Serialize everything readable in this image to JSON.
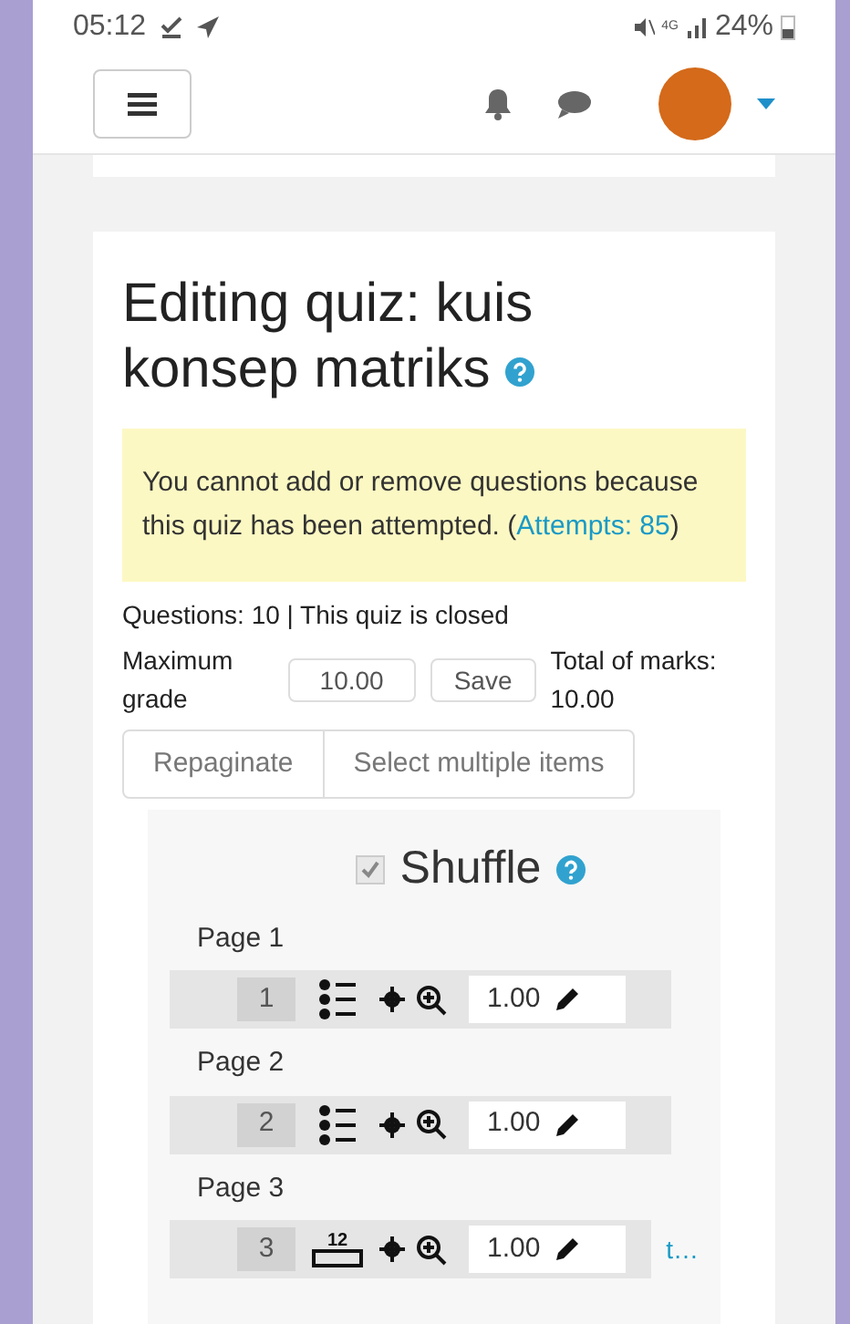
{
  "status_bar": {
    "time": "05:12",
    "network": "4G",
    "battery": "24%"
  },
  "heading": {
    "title": "Editing quiz: kuis konsep matriks"
  },
  "notice": {
    "text": "You cannot add or remove questions because this quiz has been attempted.",
    "open": "(",
    "link": "Attempts: 85",
    "close": ")"
  },
  "info": {
    "summary": "Questions: 10 | This quiz is closed",
    "max_grade_label": "Maximum grade",
    "max_grade_value": "10.00",
    "total": "Total of marks: 10.00",
    "save": "Save"
  },
  "actions": [
    "Repaginate",
    "Select multiple items"
  ],
  "shuffle": {
    "label": "Shuffle",
    "checked": true
  },
  "pages": [
    {
      "label": "Page 1",
      "question": {
        "number": "1",
        "kind": "multichoice",
        "mark": "1.00"
      }
    },
    {
      "label": "Page 2",
      "question": {
        "number": "2",
        "kind": "multichoice",
        "mark": "1.00"
      }
    },
    {
      "label": "Page 3",
      "question": {
        "number": "3",
        "kind": "numerical",
        "icon_text": "12",
        "mark": "1.00",
        "name": "t…"
      }
    }
  ]
}
